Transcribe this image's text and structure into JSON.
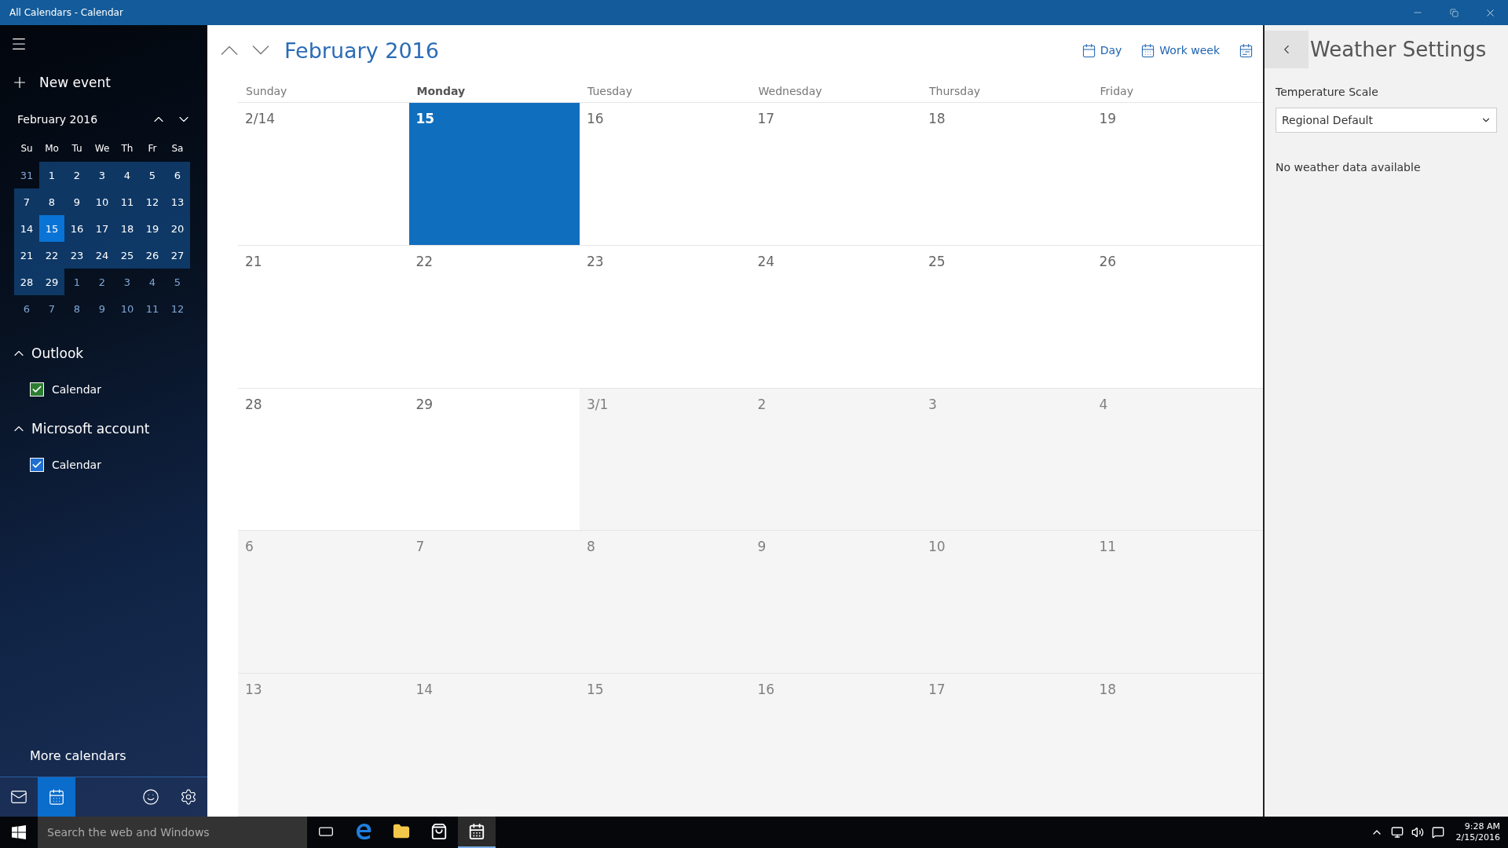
{
  "window": {
    "title": "All Calendars - Calendar"
  },
  "sidebar": {
    "new_event": "New event",
    "mini_calendar": {
      "title": "February 2016",
      "weekdays": [
        "Su",
        "Mo",
        "Tu",
        "We",
        "Th",
        "Fr",
        "Sa"
      ],
      "days": [
        {
          "label": "31",
          "in_month": false,
          "selected": false
        },
        {
          "label": "1",
          "in_month": true,
          "selected": false
        },
        {
          "label": "2",
          "in_month": true,
          "selected": false
        },
        {
          "label": "3",
          "in_month": true,
          "selected": false
        },
        {
          "label": "4",
          "in_month": true,
          "selected": false
        },
        {
          "label": "5",
          "in_month": true,
          "selected": false
        },
        {
          "label": "6",
          "in_month": true,
          "selected": false
        },
        {
          "label": "7",
          "in_month": true,
          "selected": false
        },
        {
          "label": "8",
          "in_month": true,
          "selected": false
        },
        {
          "label": "9",
          "in_month": true,
          "selected": false
        },
        {
          "label": "10",
          "in_month": true,
          "selected": false
        },
        {
          "label": "11",
          "in_month": true,
          "selected": false
        },
        {
          "label": "12",
          "in_month": true,
          "selected": false
        },
        {
          "label": "13",
          "in_month": true,
          "selected": false
        },
        {
          "label": "14",
          "in_month": true,
          "selected": false
        },
        {
          "label": "15",
          "in_month": true,
          "selected": true
        },
        {
          "label": "16",
          "in_month": true,
          "selected": false
        },
        {
          "label": "17",
          "in_month": true,
          "selected": false
        },
        {
          "label": "18",
          "in_month": true,
          "selected": false
        },
        {
          "label": "19",
          "in_month": true,
          "selected": false
        },
        {
          "label": "20",
          "in_month": true,
          "selected": false
        },
        {
          "label": "21",
          "in_month": true,
          "selected": false
        },
        {
          "label": "22",
          "in_month": true,
          "selected": false
        },
        {
          "label": "23",
          "in_month": true,
          "selected": false
        },
        {
          "label": "24",
          "in_month": true,
          "selected": false
        },
        {
          "label": "25",
          "in_month": true,
          "selected": false
        },
        {
          "label": "26",
          "in_month": true,
          "selected": false
        },
        {
          "label": "27",
          "in_month": true,
          "selected": false
        },
        {
          "label": "28",
          "in_month": true,
          "selected": false
        },
        {
          "label": "29",
          "in_month": true,
          "selected": false
        },
        {
          "label": "1",
          "in_month": false,
          "selected": false
        },
        {
          "label": "2",
          "in_month": false,
          "selected": false
        },
        {
          "label": "3",
          "in_month": false,
          "selected": false
        },
        {
          "label": "4",
          "in_month": false,
          "selected": false
        },
        {
          "label": "5",
          "in_month": false,
          "selected": false
        },
        {
          "label": "6",
          "in_month": false,
          "selected": false
        },
        {
          "label": "7",
          "in_month": false,
          "selected": false
        },
        {
          "label": "8",
          "in_month": false,
          "selected": false
        },
        {
          "label": "9",
          "in_month": false,
          "selected": false
        },
        {
          "label": "10",
          "in_month": false,
          "selected": false
        },
        {
          "label": "11",
          "in_month": false,
          "selected": false
        },
        {
          "label": "12",
          "in_month": false,
          "selected": false
        }
      ]
    },
    "accounts": [
      {
        "name": "Outlook",
        "expanded": true,
        "calendars": [
          {
            "name": "Calendar",
            "checked": true,
            "color": "#2d7d32"
          }
        ]
      },
      {
        "name": "Microsoft account",
        "expanded": true,
        "calendars": [
          {
            "name": "Calendar",
            "checked": true,
            "color": "#1e6fd0"
          }
        ]
      }
    ],
    "more_calendars": "More calendars",
    "nav": [
      {
        "kind": "mail",
        "selected": false
      },
      {
        "kind": "calendar",
        "selected": true
      },
      {
        "kind": "feedback",
        "selected": false
      },
      {
        "kind": "settings",
        "selected": false
      }
    ]
  },
  "toolbar": {
    "title": "February 2016",
    "views": [
      {
        "kind": "day",
        "label": "Day"
      },
      {
        "kind": "workweek",
        "label": "Work week"
      },
      {
        "kind": "week"
      }
    ]
  },
  "month": {
    "weekdays": [
      {
        "label": "Sunday",
        "selected": false
      },
      {
        "label": "Monday",
        "selected": true
      },
      {
        "label": "Tuesday",
        "selected": false
      },
      {
        "label": "Wednesday",
        "selected": false
      },
      {
        "label": "Thursday",
        "selected": false
      },
      {
        "label": "Friday",
        "selected": false
      }
    ],
    "weeks": [
      {
        "days": [
          {
            "label": "2/14",
            "in_month": true,
            "selected": false
          },
          {
            "label": "15",
            "in_month": true,
            "selected": true
          },
          {
            "label": "16",
            "in_month": true,
            "selected": false
          },
          {
            "label": "17",
            "in_month": true,
            "selected": false
          },
          {
            "label": "18",
            "in_month": true,
            "selected": false
          },
          {
            "label": "19",
            "in_month": true,
            "selected": false
          }
        ]
      },
      {
        "days": [
          {
            "label": "21",
            "in_month": true,
            "selected": false
          },
          {
            "label": "22",
            "in_month": true,
            "selected": false
          },
          {
            "label": "23",
            "in_month": true,
            "selected": false
          },
          {
            "label": "24",
            "in_month": true,
            "selected": false
          },
          {
            "label": "25",
            "in_month": true,
            "selected": false
          },
          {
            "label": "26",
            "in_month": true,
            "selected": false
          }
        ]
      },
      {
        "days": [
          {
            "label": "28",
            "in_month": true,
            "selected": false
          },
          {
            "label": "29",
            "in_month": true,
            "selected": false
          },
          {
            "label": "3/1",
            "in_month": false,
            "selected": false
          },
          {
            "label": "2",
            "in_month": false,
            "selected": false
          },
          {
            "label": "3",
            "in_month": false,
            "selected": false
          },
          {
            "label": "4",
            "in_month": false,
            "selected": false
          }
        ]
      },
      {
        "days": [
          {
            "label": "6",
            "in_month": false,
            "selected": false
          },
          {
            "label": "7",
            "in_month": false,
            "selected": false
          },
          {
            "label": "8",
            "in_month": false,
            "selected": false
          },
          {
            "label": "9",
            "in_month": false,
            "selected": false
          },
          {
            "label": "10",
            "in_month": false,
            "selected": false
          },
          {
            "label": "11",
            "in_month": false,
            "selected": false
          }
        ]
      },
      {
        "days": [
          {
            "label": "13",
            "in_month": false,
            "selected": false
          },
          {
            "label": "14",
            "in_month": false,
            "selected": false
          },
          {
            "label": "15",
            "in_month": false,
            "selected": false
          },
          {
            "label": "16",
            "in_month": false,
            "selected": false
          },
          {
            "label": "17",
            "in_month": false,
            "selected": false
          },
          {
            "label": "18",
            "in_month": false,
            "selected": false
          }
        ]
      }
    ]
  },
  "weather_panel": {
    "title": "Weather Settings",
    "field_label": "Temperature Scale",
    "scale_value": "Regional Default",
    "message": "No weather data available"
  },
  "taskbar": {
    "search_placeholder": "Search the web and Windows",
    "apps": [
      {
        "kind": "taskview",
        "selected": false
      },
      {
        "kind": "edge",
        "selected": false
      },
      {
        "kind": "explorer",
        "selected": false
      },
      {
        "kind": "store",
        "selected": false
      },
      {
        "kind": "calendar",
        "selected": true
      }
    ],
    "time": "9:28 AM",
    "date": "2/15/2016"
  }
}
